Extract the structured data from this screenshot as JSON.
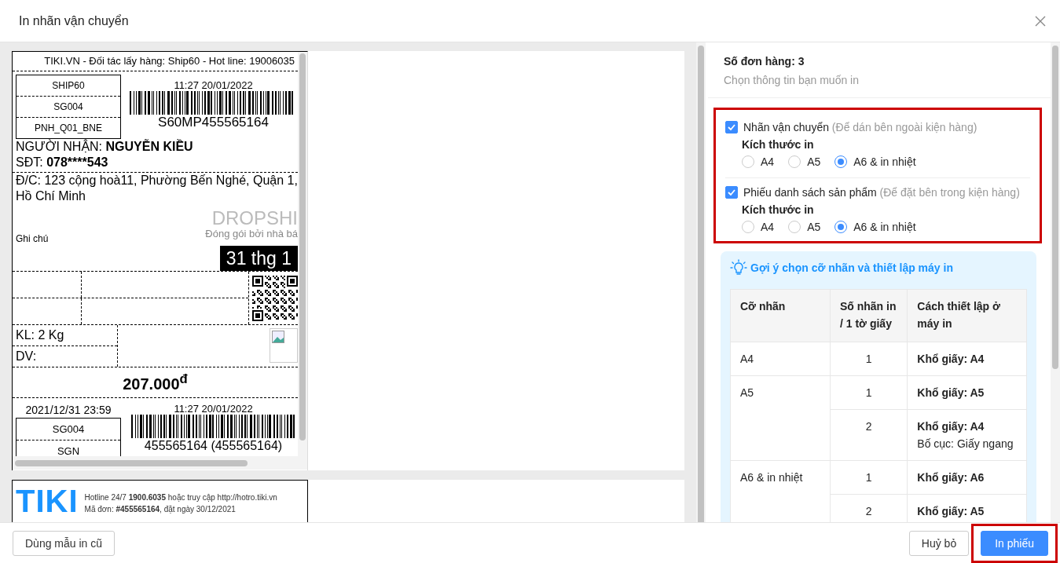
{
  "dialog": {
    "title": "In nhãn vận chuyển"
  },
  "label_preview": {
    "header": "TIKI.VN - Đối tác lấy hàng: Ship60 - Hot line: 19006035",
    "route_codes": [
      "SHIP60",
      "SG004",
      "PNH_Q01_BNE"
    ],
    "print_time": "11:27 20/01/2022",
    "tracking_code": "S60MP455565164",
    "recipient": "NGƯỜI NHẬN: **NGUYỄN KIỀU**",
    "phone_label": "SĐT:",
    "phone": "078****543",
    "address_lines": [
      "Đ/C: 123 cộng hoà11, Phường Bến Nghé, Quận 1,",
      "Hồ Chí Minh"
    ],
    "dropship_title": "DROPSHI",
    "dropship_note": "Đóng gói bởi nhà bá",
    "note_label": "Ghi chú",
    "delivery_date": "31 thg 1",
    "weight": "KL: 2 Kg",
    "service": "DV:",
    "cod_amount": "207.000$^{đ}$",
    "deadline": "2021/12/31 23:59",
    "sort_codes": [
      "SG004",
      "SGN"
    ],
    "print_time_2": "11:27 20/01/2022",
    "order_code": "455565164 (455565164)"
  },
  "invoice_preview": {
    "logo": "TIKI",
    "hotline": "Hotline 24/7 **1900.6035** hoặc truy cập http://hotro.tiki.vn",
    "order": "Mã đơn: **#455565164**, đặt ngày 30/12/2021"
  },
  "order_summary": {
    "count": "Số đơn hàng: 3",
    "hint": "Chọn thông tin bạn muốn in"
  },
  "print_options": {
    "highlighted": true,
    "items": [
      {
        "label": "Nhãn vận chuyển",
        "note": "(Để dán bên ngoài kiện hàng)",
        "checked": true,
        "size_label": "Kích thước in",
        "sizes": [
          {
            "label": "A4",
            "selected": false
          },
          {
            "label": "A5",
            "selected": false
          },
          {
            "label": "A6 & in nhiệt",
            "selected": true
          }
        ]
      },
      {
        "label": "Phiếu danh sách sản phẩm",
        "note": "(Để đặt bên trong kiện hàng)",
        "checked": true,
        "size_label": "Kích thước in",
        "sizes": [
          {
            "label": "A4",
            "selected": false
          },
          {
            "label": "A5",
            "selected": false
          },
          {
            "label": "A6 & in nhiệt",
            "selected": true
          }
        ]
      }
    ]
  },
  "suggestion": {
    "title": "Gợi ý chọn cỡ nhãn và thiết lập máy in",
    "columns": [
      "Cỡ nhãn",
      "Số nhãn in / 1 tờ giấy",
      "Cách thiết lập ở máy in"
    ],
    "rows": [
      {
        "size": "A4",
        "options": [
          {
            "count": "1",
            "paper": "Khổ giấy: A4"
          }
        ]
      },
      {
        "size": "A5",
        "options": [
          {
            "count": "1",
            "paper": "Khổ giấy: A5"
          },
          {
            "count": "2",
            "paper": "Khổ giấy: A4",
            "layout": "Bố cục: Giấy ngang"
          }
        ]
      },
      {
        "size": "A6 & in nhiệt",
        "options": [
          {
            "count": "1",
            "paper": "Khổ giấy: A6"
          },
          {
            "count": "2",
            "paper": "Khổ giấy: A5"
          }
        ]
      }
    ]
  },
  "footer": {
    "old_template_button": "Dùng mẫu in cũ",
    "cancel_button": "Huỷ bỏ",
    "print_button": {
      "label": "In phiếu",
      "highlighted": true
    }
  }
}
